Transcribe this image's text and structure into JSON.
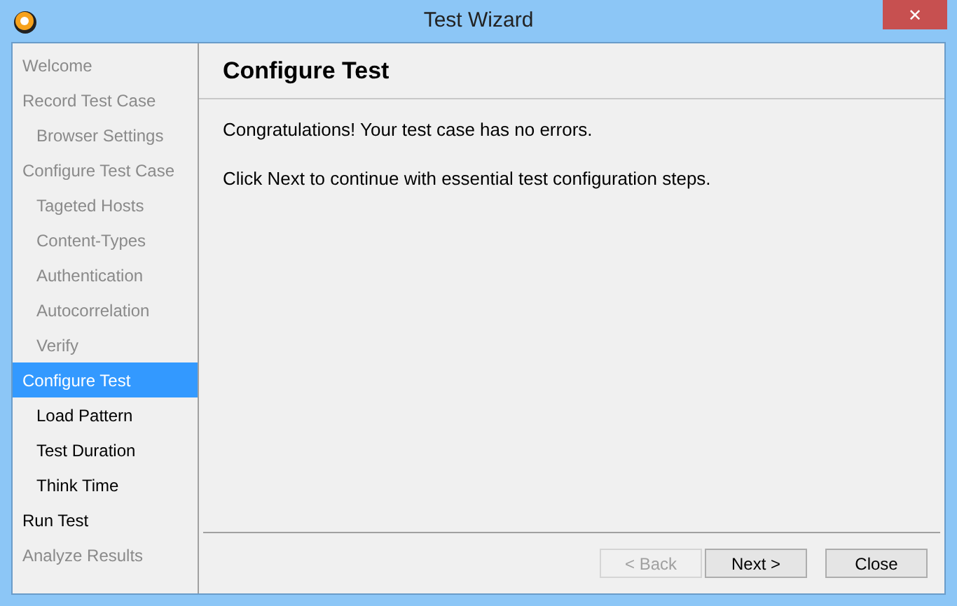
{
  "window": {
    "title": "Test Wizard",
    "close": "✕"
  },
  "steps": [
    {
      "label": "Welcome",
      "enabled": false,
      "selected": false
    },
    {
      "label": "Record Test Case",
      "enabled": false,
      "selected": false,
      "children": [
        {
          "label": "Browser Settings",
          "enabled": false,
          "selected": false
        }
      ]
    },
    {
      "label": "Configure Test Case",
      "enabled": false,
      "selected": false,
      "children": [
        {
          "label": "Tageted Hosts",
          "enabled": false,
          "selected": false
        },
        {
          "label": "Content-Types",
          "enabled": false,
          "selected": false
        },
        {
          "label": "Authentication",
          "enabled": false,
          "selected": false
        },
        {
          "label": "Autocorrelation",
          "enabled": false,
          "selected": false
        },
        {
          "label": "Verify",
          "enabled": false,
          "selected": false
        }
      ]
    },
    {
      "label": "Configure Test",
      "enabled": true,
      "selected": true,
      "children": [
        {
          "label": "Load Pattern",
          "enabled": true,
          "selected": false
        },
        {
          "label": "Test Duration",
          "enabled": true,
          "selected": false
        },
        {
          "label": "Think Time",
          "enabled": true,
          "selected": false
        }
      ]
    },
    {
      "label": "Run Test",
      "enabled": true,
      "selected": false
    },
    {
      "label": "Analyze Results",
      "enabled": false,
      "selected": false
    }
  ],
  "page": {
    "heading": "Configure Test",
    "paragraphs": [
      "Congratulations! Your test case has no errors.",
      "Click Next to continue with essential test configuration steps."
    ]
  },
  "buttons": [
    {
      "label": "< Back",
      "disabled": true
    },
    {
      "label": "Next >",
      "disabled": false
    },
    {
      "label": "Close",
      "disabled": false
    }
  ]
}
